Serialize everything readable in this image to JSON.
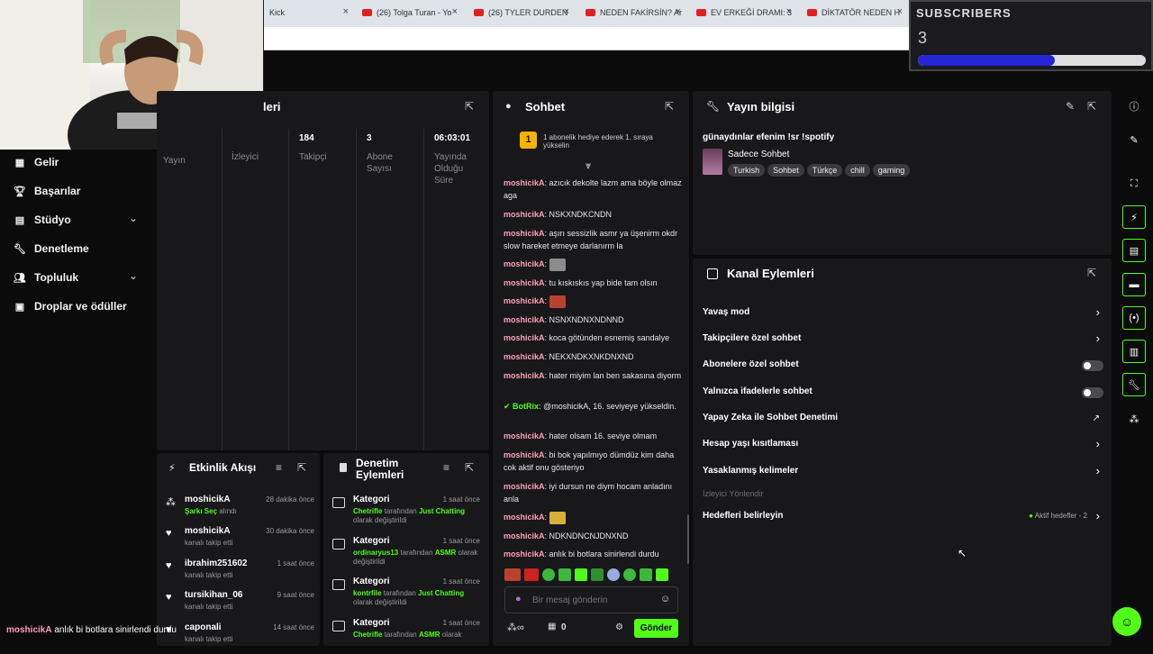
{
  "browser": {
    "tabs": [
      {
        "title": "Kick"
      },
      {
        "title": "(26) Tolga Turan - Yo"
      },
      {
        "title": "(26) TYLER DURDEN"
      },
      {
        "title": "NEDEN FAKİRSİN? Ar"
      },
      {
        "title": "EV ERKEĞİ DRAMI: 3"
      },
      {
        "title": "DİKTATÖR NEDEN H"
      }
    ],
    "window_controls": [
      "—",
      "❐",
      "✕"
    ]
  },
  "sub_widget": {
    "title": "SUBSCRIBERS",
    "count": "3",
    "progress": 0.6
  },
  "sidebar": {
    "items": [
      {
        "label": "Gelir",
        "icon": "chart-icon"
      },
      {
        "label": "Başarılar",
        "icon": "trophy-icon"
      },
      {
        "label": "Stüdyo",
        "icon": "layout-icon"
      },
      {
        "label": "Denetleme",
        "icon": "wrench-icon"
      },
      {
        "label": "Topluluk",
        "icon": "users-icon"
      },
      {
        "label": "Droplar ve ödüller",
        "icon": "gift-icon"
      }
    ]
  },
  "stats": {
    "title_fragment": "leri",
    "cols": [
      {
        "value": "",
        "label": "Yayın"
      },
      {
        "value": "",
        "label": "İzleyici"
      },
      {
        "value": "184",
        "label": "Takipçi"
      },
      {
        "value": "3",
        "label": "Abone Sayısı"
      },
      {
        "value": "06:03:01",
        "label": "Yayında Olduğu Süre"
      }
    ]
  },
  "chat": {
    "title": "Sohbet",
    "pinned": "1 abonelik hediye ederek 1. sıraya yükselin",
    "pinned_rank": "1",
    "messages": [
      {
        "user": "moshicikA",
        "text": "azıcık dekolte lazm ama böyle olmaz aga"
      },
      {
        "user": "moshicikA",
        "text": "NSKXNDKCNDN"
      },
      {
        "user": "moshicikA",
        "text": "aşırı sessizlik asmr ya üşenirm okdr slow hareket etmeye darlanırm la"
      },
      {
        "user": "moshicikA",
        "text": ""
      },
      {
        "user": "moshicikA",
        "text": "tu kıskıskıs yap bide tam olsın"
      },
      {
        "user": "moshicikA",
        "text": ""
      },
      {
        "user": "moshicikA",
        "text": "NSNXNDNXNDNND"
      },
      {
        "user": "moshicikA",
        "text": "koca götünden esnemiş sandalye"
      },
      {
        "user": "moshicikA",
        "text": "NEKXNDKXNKDNXND"
      },
      {
        "user": "moshicikA",
        "text": "hater miyim lan ben sakasına diyorm"
      },
      {
        "user": "BotRix",
        "text": "@moshicikA, 16. seviyeye yükseldin."
      },
      {
        "user": "moshicikA",
        "text": "hater olsam 16. seviye olmam"
      },
      {
        "user": "moshicikA",
        "text": "bi bok yapılmıyo dümdüz kim daha cok aktif onu gösteriyo"
      },
      {
        "user": "moshicikA",
        "text": "iyi dursun ne diym hocam anladını anla"
      },
      {
        "user": "moshicikA",
        "text": ""
      },
      {
        "user": "moshicikA",
        "text": "NDKNDNCNJDNXND"
      },
      {
        "user": "moshicikA",
        "text": "anlık bi botlara sinirlendi durdu"
      }
    ],
    "input_placeholder": "Bir mesaj gönderin",
    "points": "0",
    "send_label": "Gönder"
  },
  "stream_info": {
    "title": "Yayın bilgisi",
    "stream_title": "günaydınlar efenim !sr !spotify",
    "category": "Sadece Sohbet",
    "tags": [
      "Turkish",
      "Sohbet",
      "Türkçe",
      "chill",
      "gaming"
    ]
  },
  "channel_actions": {
    "title": "Kanal Eylemleri",
    "items": [
      {
        "label": "Yavaş mod",
        "kind": "chevron"
      },
      {
        "label": "Takipçilere özel sohbet",
        "kind": "chevron"
      },
      {
        "label": "Abonelere özel sohbet",
        "kind": "toggle",
        "on": false
      },
      {
        "label": "Yalnızca ifadelerle sohbet",
        "kind": "toggle",
        "on": false
      },
      {
        "label": "Yapay Zeka ile Sohbet Denetimi",
        "kind": "external"
      },
      {
        "label": "Hesap yaşı kısıtlaması",
        "kind": "chevron"
      },
      {
        "label": "Yasaklanmış kelimeler",
        "kind": "chevron"
      }
    ],
    "section_label": "İzleyici Yönlendir",
    "goals_label": "Hedefleri belirleyin",
    "goals_status": "Aktif hedefler - 2"
  },
  "activity": {
    "title": "Etkinlik Akışı",
    "items": [
      {
        "user": "moshicikA",
        "time": "28 dakika önce",
        "green": "Şarkı Seç",
        "rest": "alındı",
        "icon": "gift-icon"
      },
      {
        "user": "moshicikA",
        "time": "30 dakika önce",
        "green": "",
        "rest": "kanalı takip etti",
        "icon": "heart-icon"
      },
      {
        "user": "ibrahim251602",
        "time": "1 saat önce",
        "green": "",
        "rest": "kanalı takip etti",
        "icon": "heart-icon"
      },
      {
        "user": "tursikihan_06",
        "time": "9 saat önce",
        "green": "",
        "rest": "kanalı takip etti",
        "icon": "heart-icon"
      },
      {
        "user": "caponali",
        "time": "14 saat önce",
        "green": "",
        "rest": "kanalı takip etti",
        "icon": "heart-icon"
      }
    ]
  },
  "mod_actions": {
    "title": "Denetim Eylemleri",
    "items": [
      {
        "title": "Kategori",
        "time": "1 saat önce",
        "who": "Chetrifle",
        "mid": "tarafından",
        "cat": "Just Chatting",
        "end": "olarak değiştirildi"
      },
      {
        "title": "Kategori",
        "time": "1 saat önce",
        "who": "ordinaryus13",
        "mid": "tarafından",
        "cat": "ASMR",
        "end": "olarak değiştirildi"
      },
      {
        "title": "Kategori",
        "time": "1 saat önce",
        "who": "kontrfile",
        "mid": "tarafından",
        "cat": "Just Chatting",
        "end": "olarak değiştirildi"
      },
      {
        "title": "Kategori",
        "time": "1 saat önce",
        "who": "Chetrifle",
        "mid": "tarafından",
        "cat": "ASMR",
        "end": "olarak"
      }
    ]
  },
  "overlay_caption": {
    "user": "moshicikA",
    "text": "anlık bi botlara sinirlendi durdu"
  },
  "colors": {
    "accent": "#53fc18",
    "panel": "#18181b",
    "bg": "#0b0b0c",
    "username": "#ff9fb8"
  }
}
